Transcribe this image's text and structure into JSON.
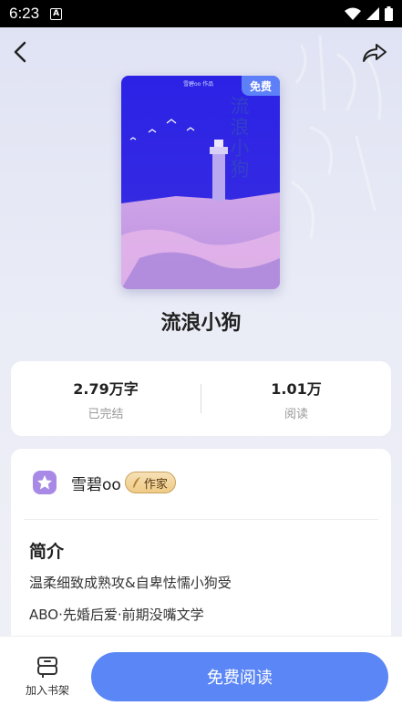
{
  "status_bar": {
    "time": "6:23",
    "notification_icon": "A"
  },
  "topbar": {
    "back_icon": "chevron-left-icon",
    "share_icon": "share-icon"
  },
  "cover": {
    "badge": "免费",
    "small_text": "雪碧oo 作品",
    "title": "流浪小狗"
  },
  "book": {
    "title": "流浪小狗"
  },
  "stats": [
    {
      "value": "2.79万字",
      "label": "已完结"
    },
    {
      "value": "1.01万",
      "label": "阅读"
    }
  ],
  "author": {
    "name": "雪碧oo",
    "badge": "作家"
  },
  "intro": {
    "heading": "简介",
    "line1": "温柔细致成熟攻&自卑怯懦小狗受",
    "line2": "ABO·先婚后爱·前期没嘴文学"
  },
  "bottom": {
    "shelf_label": "加入书架",
    "read_label": "免费阅读"
  },
  "colors": {
    "accent": "#5b86f5",
    "cover_blue": "#2a25d8",
    "badge_gold": "#efcb86"
  }
}
